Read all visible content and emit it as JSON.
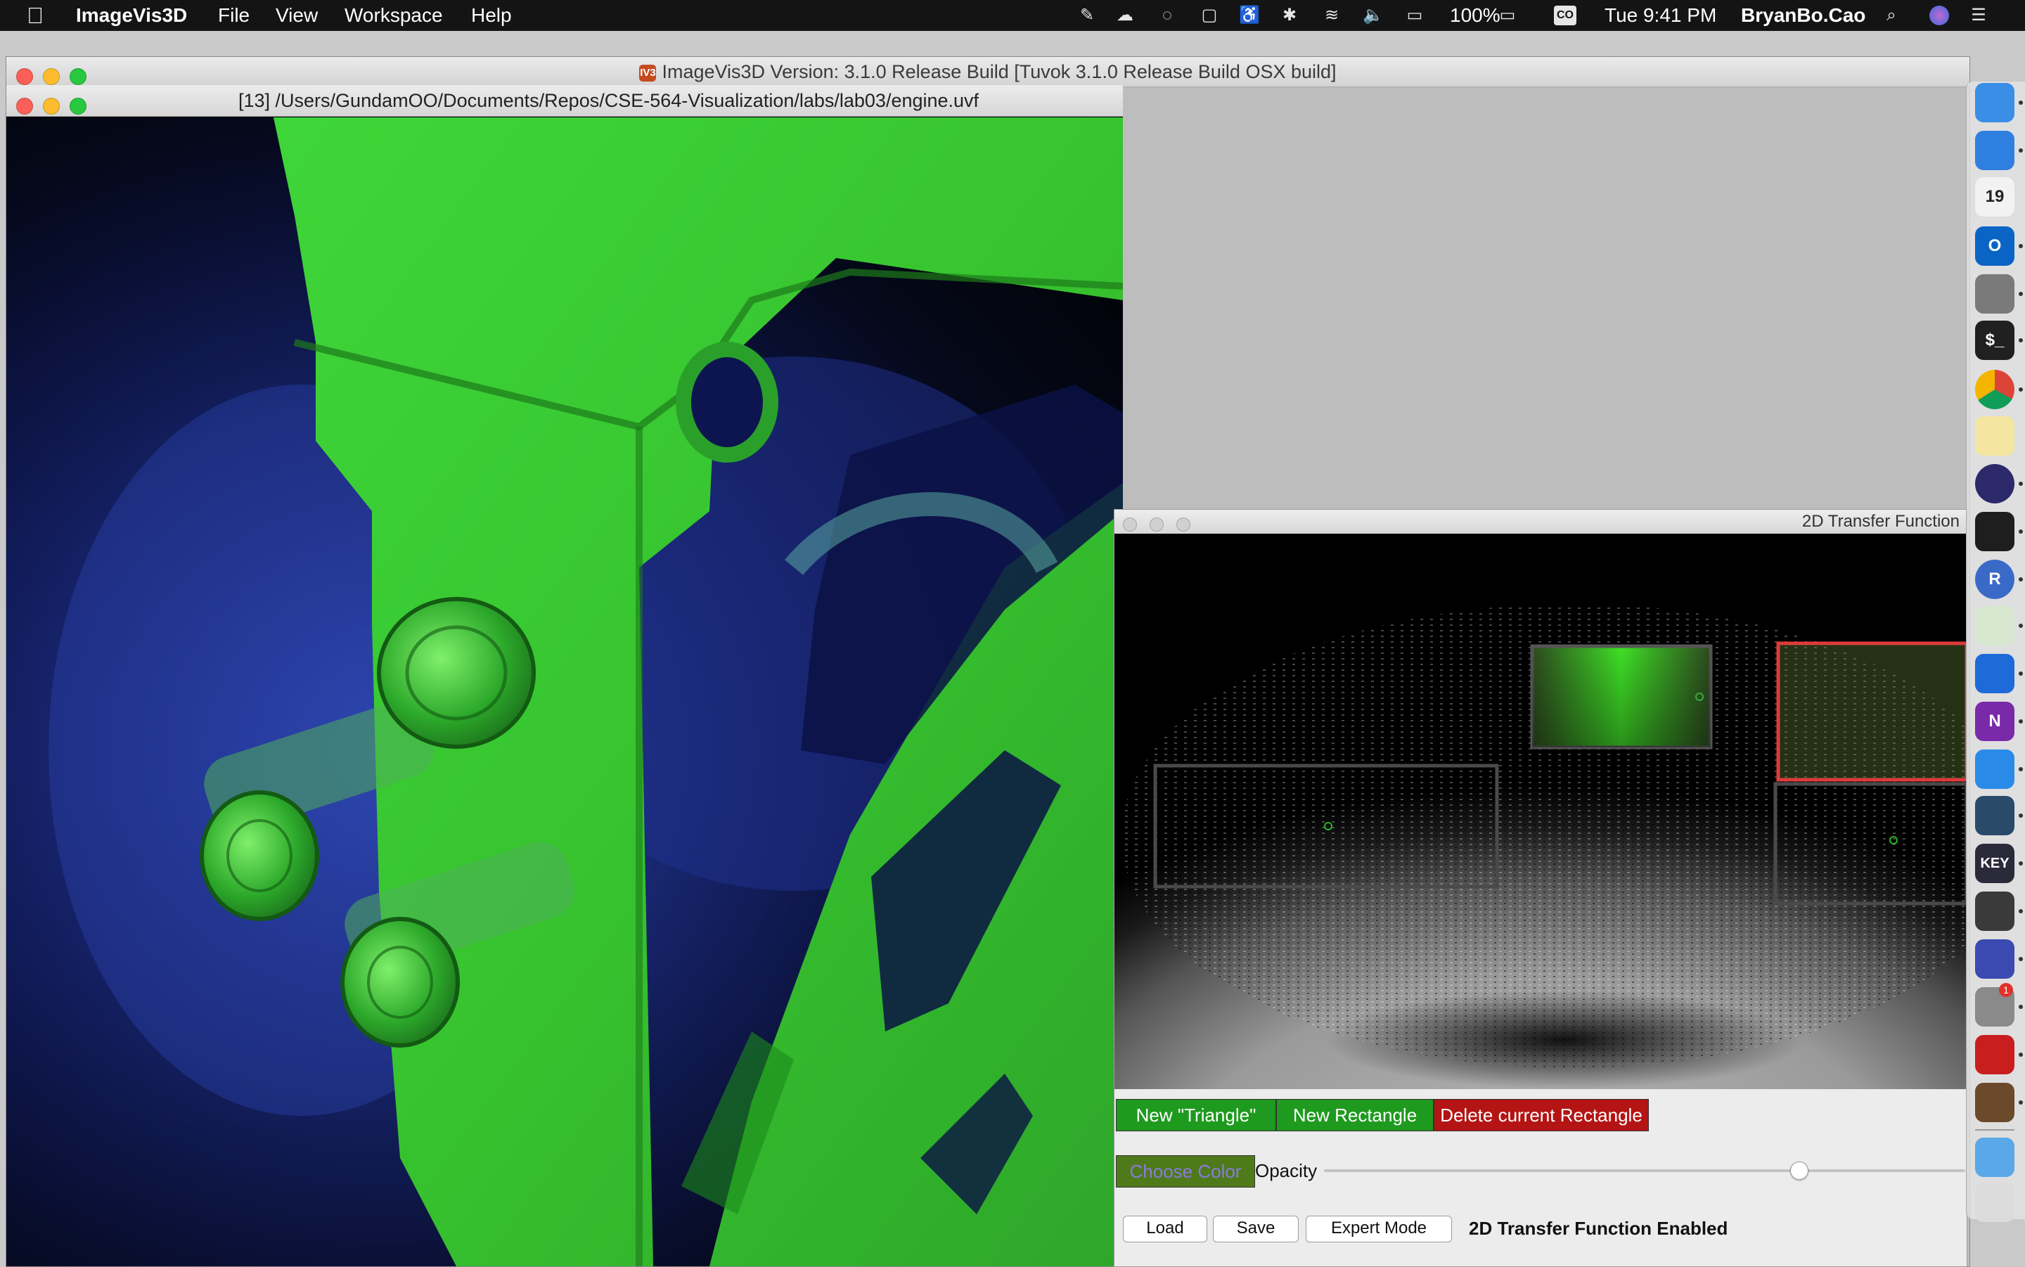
{
  "menubar": {
    "app_name": "ImageVis3D",
    "menus": [
      "File",
      "View",
      "Workspace",
      "Help"
    ],
    "battery": "100%",
    "clock": "Tue 9:41 PM",
    "user": "BryanBo.Cao",
    "co_badge": "CO"
  },
  "main_window": {
    "title": "ImageVis3D Version: 3.1.0 Release Build [Tuvok 3.1.0 Release Build OSX build]",
    "badge": "IV3"
  },
  "render_window": {
    "title": "[13] /Users/GundamOO/Documents/Repos/CSE-564-Visualization/labs/lab03/engine.uvf"
  },
  "tf_window": {
    "title": "2D Transfer Function",
    "buttons": {
      "new_triangle": "New \"Triangle\"",
      "new_rectangle": "New Rectangle",
      "delete_rectangle": "Delete current Rectangle",
      "choose_color": "Choose Color",
      "load": "Load",
      "save": "Save",
      "expert_mode": "Expert Mode"
    },
    "opacity_label": "Opacity",
    "opacity_value": 0.74,
    "status": "2D Transfer Function Enabled",
    "colors": {
      "green_button": "#1e9a1e",
      "red_button": "#b41414",
      "choose_color_bg": "#4f7a1a",
      "choose_color_text": "#8a7ae0",
      "selected_widget": "#e03a3a"
    }
  },
  "dock": {
    "items": [
      {
        "icon": "finder-icon",
        "label": ""
      },
      {
        "icon": "pen-app-icon",
        "label": ""
      },
      {
        "icon": "calendar-icon",
        "label": "19"
      },
      {
        "icon": "outlook-icon",
        "label": "O"
      },
      {
        "icon": "launchpad-icon",
        "label": ""
      },
      {
        "icon": "terminal-icon",
        "label": "$_"
      },
      {
        "icon": "chrome-icon",
        "label": ""
      },
      {
        "icon": "notes-icon",
        "label": ""
      },
      {
        "icon": "eclipse-icon",
        "label": ""
      },
      {
        "icon": "activity-monitor-icon",
        "label": ""
      },
      {
        "icon": "r-icon",
        "label": "R"
      },
      {
        "icon": "maps-icon",
        "label": ""
      },
      {
        "icon": "teamviewer-icon",
        "label": ""
      },
      {
        "icon": "onenote-icon",
        "label": "N"
      },
      {
        "icon": "zoom-icon",
        "label": ""
      },
      {
        "icon": "quicktime-icon",
        "label": ""
      },
      {
        "icon": "keynote-icon",
        "label": "KEY"
      },
      {
        "icon": "davinci-icon",
        "label": ""
      },
      {
        "icon": "color-icon",
        "label": ""
      },
      {
        "icon": "system-preferences-icon",
        "label": ""
      },
      {
        "icon": "acrobat-icon",
        "label": ""
      },
      {
        "icon": "imagevis3d-icon",
        "label": ""
      },
      {
        "icon": "downloads-folder-icon",
        "label": ""
      },
      {
        "icon": "trash-icon",
        "label": ""
      }
    ],
    "badge_count": "1"
  }
}
